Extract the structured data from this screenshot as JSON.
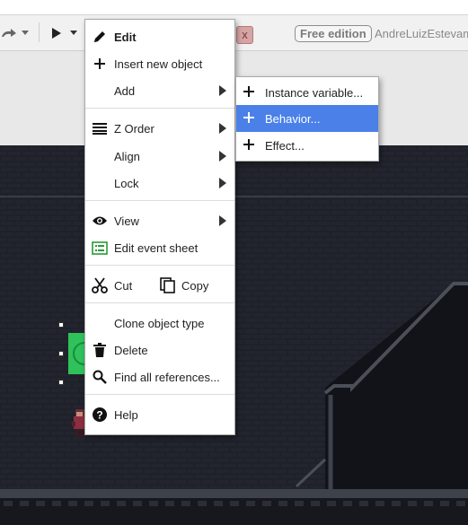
{
  "toolbar": {
    "edition_badge": "Free edition",
    "username": "AndreLuizEstevam",
    "tab_close": "x"
  },
  "context_menu": {
    "items": [
      {
        "label": "Edit",
        "icon": "pencil-icon"
      },
      {
        "label": "Insert new object",
        "icon": "plus-icon"
      },
      {
        "label": "Add",
        "icon": "",
        "submenu": true
      },
      {
        "label": "Z Order",
        "icon": "list-icon",
        "submenu": true
      },
      {
        "label": "Align",
        "icon": "",
        "submenu": true
      },
      {
        "label": "Lock",
        "icon": "",
        "submenu": true
      },
      {
        "label": "View",
        "icon": "eye-icon",
        "submenu": true
      },
      {
        "label": "Edit event sheet",
        "icon": "event-sheet-icon"
      },
      {
        "label": "Cut",
        "icon": "scissors-icon"
      },
      {
        "label": "Copy",
        "icon": "copy-icon"
      },
      {
        "label": "Clone object type",
        "icon": ""
      },
      {
        "label": "Delete",
        "icon": "trash-icon"
      },
      {
        "label": "Find all references...",
        "icon": "search-icon"
      },
      {
        "label": "Help",
        "icon": "help-icon"
      }
    ]
  },
  "add_submenu": {
    "items": [
      {
        "label": "Instance variable...",
        "icon": "plus-icon"
      },
      {
        "label": "Behavior...",
        "icon": "plus-icon",
        "highlighted": true
      },
      {
        "label": "Effect...",
        "icon": "plus-icon"
      }
    ]
  },
  "colors": {
    "highlight": "#4a80e8",
    "level_background": "#1e2129",
    "selected_sprite": "#2fc25b"
  }
}
